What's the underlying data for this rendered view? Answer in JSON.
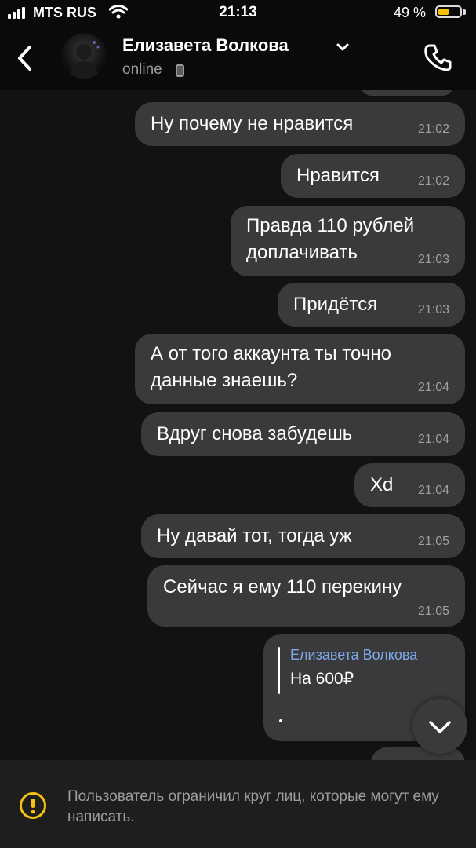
{
  "status_bar": {
    "carrier": "MTS RUS",
    "time": "21:13",
    "battery_percent": "49 %",
    "battery_level": 0.49,
    "battery_color": "#f4c20d"
  },
  "header": {
    "contact_name": "Елизавета Волкова",
    "contact_status": "online"
  },
  "messages": [
    {
      "text": "Ну почему не нравится",
      "time": "21:02"
    },
    {
      "text": "Нравится",
      "time": "21:02"
    },
    {
      "text": "Правда 110 рублей",
      "text2": "доплачивать",
      "time": "21:03"
    },
    {
      "text": "Придётся",
      "time": "21:03"
    },
    {
      "text": "А от того аккаунта ты точно",
      "text2": "данные знаешь?",
      "time": "21:04"
    },
    {
      "text": "Вдруг снова забудешь",
      "time": "21:04"
    },
    {
      "text": "Xd",
      "time": "21:04"
    },
    {
      "text": "Ну давай тот, тогда уж",
      "time": "21:05"
    },
    {
      "text": "Сейчас я ему 110 перекину",
      "time": "21:05"
    },
    {
      "reply_to": "Елизавета Волкова",
      "reply_text": "На 600₽"
    }
  ],
  "footer": {
    "notice": "Пользователь ограничил круг лиц, которые могут ему написать."
  },
  "colors": {
    "bubble": "#3a3a3c",
    "reply_name": "#7ea9e8",
    "warning_accent": "#f4c20d"
  }
}
